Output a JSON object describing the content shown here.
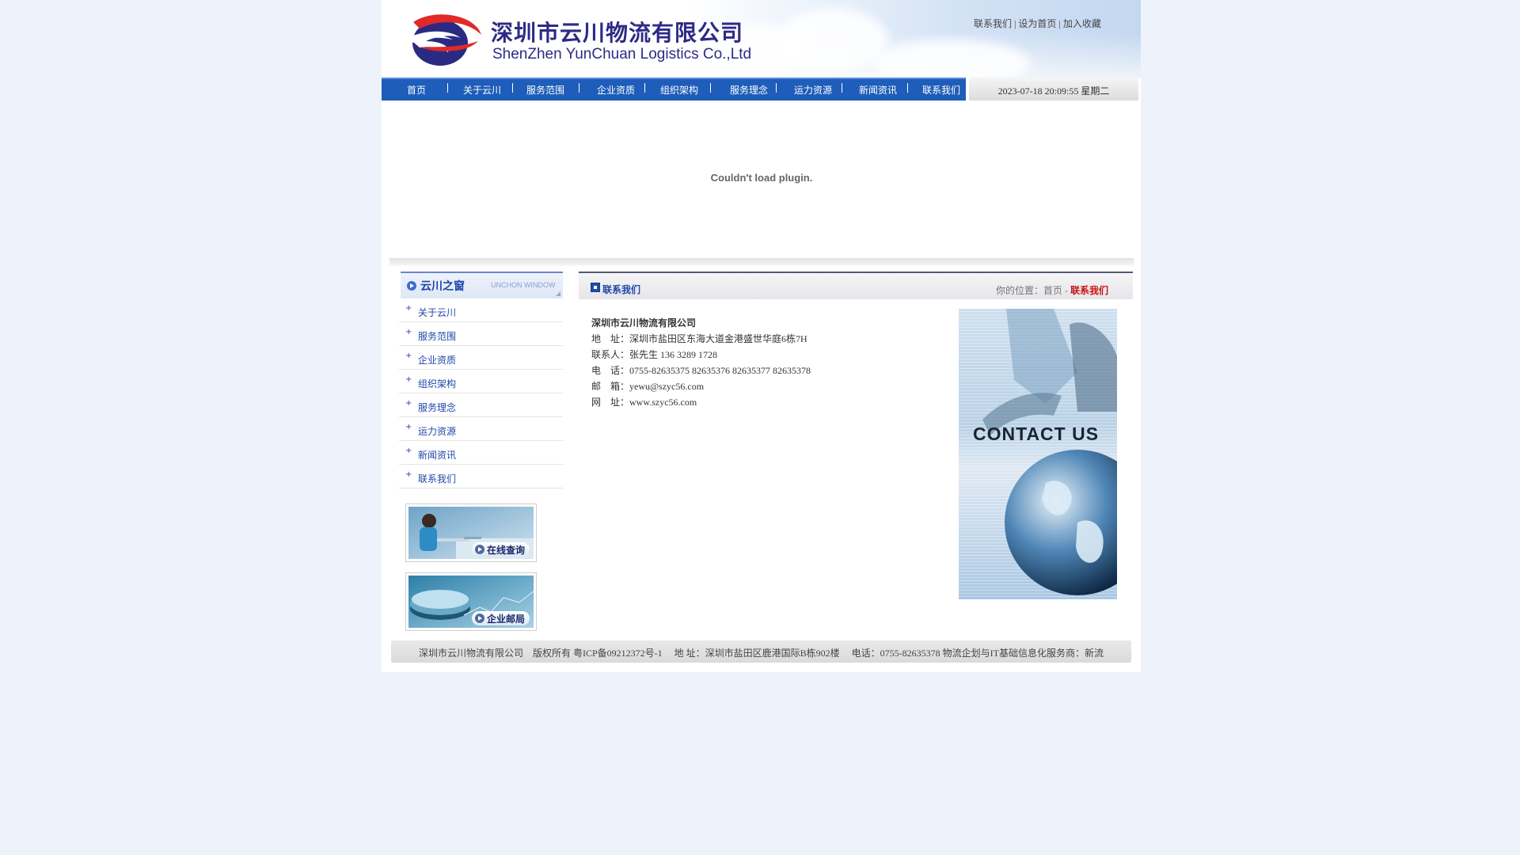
{
  "header": {
    "company_cn": "深圳市云川物流有限公司",
    "company_en": "ShenZhen YunChuan Logistics Co.,Ltd",
    "toplinks": [
      "联系我们",
      "设为首页",
      "加入收藏"
    ],
    "toplink_separator": " | "
  },
  "nav": {
    "items": [
      "首页",
      "关于云川",
      "服务范围",
      "企业资质",
      "组织架构",
      "服务理念",
      "运力资源",
      "新闻资讯",
      "联系我们"
    ]
  },
  "datetime": "2023-07-18 20:09:55 星期二",
  "plugin": {
    "message": "Couldn't load plugin."
  },
  "sidebar": {
    "title": "云川之窗",
    "subtitle": "UNCHON WINDOW",
    "items": [
      "关于云川",
      "服务范围",
      "企业资质",
      "组织架构",
      "服务理念",
      "运力资源",
      "新闻资讯",
      "联系我们"
    ],
    "promo_online": "在线查询",
    "promo_mail": "企业邮局"
  },
  "main": {
    "title": "联系我们",
    "crumb_prefix": "你的位置：",
    "crumb_home": "首页",
    "crumb_sep": " - ",
    "crumb_current": "联系我们",
    "contact_image_text": "CONTACT US"
  },
  "contact": {
    "company": "深圳市云川物流有限公司",
    "address_label": "地　址：",
    "address": "深圳市盐田区东海大道金港盛世华庭6栋7H",
    "person_label": "联系人：",
    "person": "张先生 136 3289 1728",
    "phone_label": "电　话：",
    "phone": "0755-82635375 82635376 82635377 82635378",
    "email_label": "邮　箱：",
    "email": "yewu@szyc56.com",
    "web_label": "网　址：",
    "web": "www.szyc56.com"
  },
  "footer": {
    "text": "深圳市云川物流有限公司　版权所有 粤ICP备09212372号-1　 地 址：深圳市盐田区鹿港国际B栋902楼　 电话：0755-82635378 物流企划与IT基础信息化服务商：新流"
  },
  "colors": {
    "nav_bg": "#1e5db9",
    "brand_text": "#2e2a86",
    "link_blue": "#1f47a8",
    "crumb_current": "#cc1111",
    "logo_red": "#e02a2a"
  }
}
